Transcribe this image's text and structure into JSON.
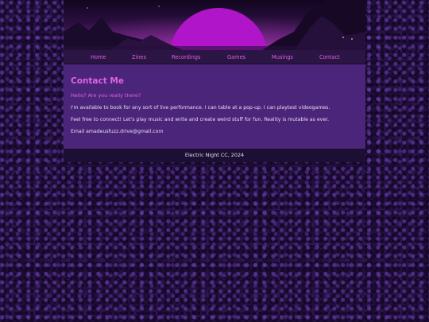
{
  "nav": {
    "items": [
      {
        "label": "Home"
      },
      {
        "label": "Zines"
      },
      {
        "label": "Recordings"
      },
      {
        "label": "Games"
      },
      {
        "label": "Musings"
      },
      {
        "label": "Contact"
      }
    ]
  },
  "main": {
    "title": "Contact Me",
    "subtitle": "Hello? Are you really there?",
    "paragraphs": [
      "I'm available to book for any sort of live performance. I can table at a pop-up. I can playtest videogames.",
      "Feel free to connect! Let's play music and write and create weird stuff for fun. Reality is mutable as ever.",
      "Email amadeusfuzz.drive@gmail.com"
    ]
  },
  "footer": {
    "text": "Electric Night CC, 2024"
  },
  "colors": {
    "accent": "#e062e6",
    "content_bg": "#4b2579",
    "nav_bg": "#2a1545",
    "footer_bg": "#1c0f33"
  }
}
